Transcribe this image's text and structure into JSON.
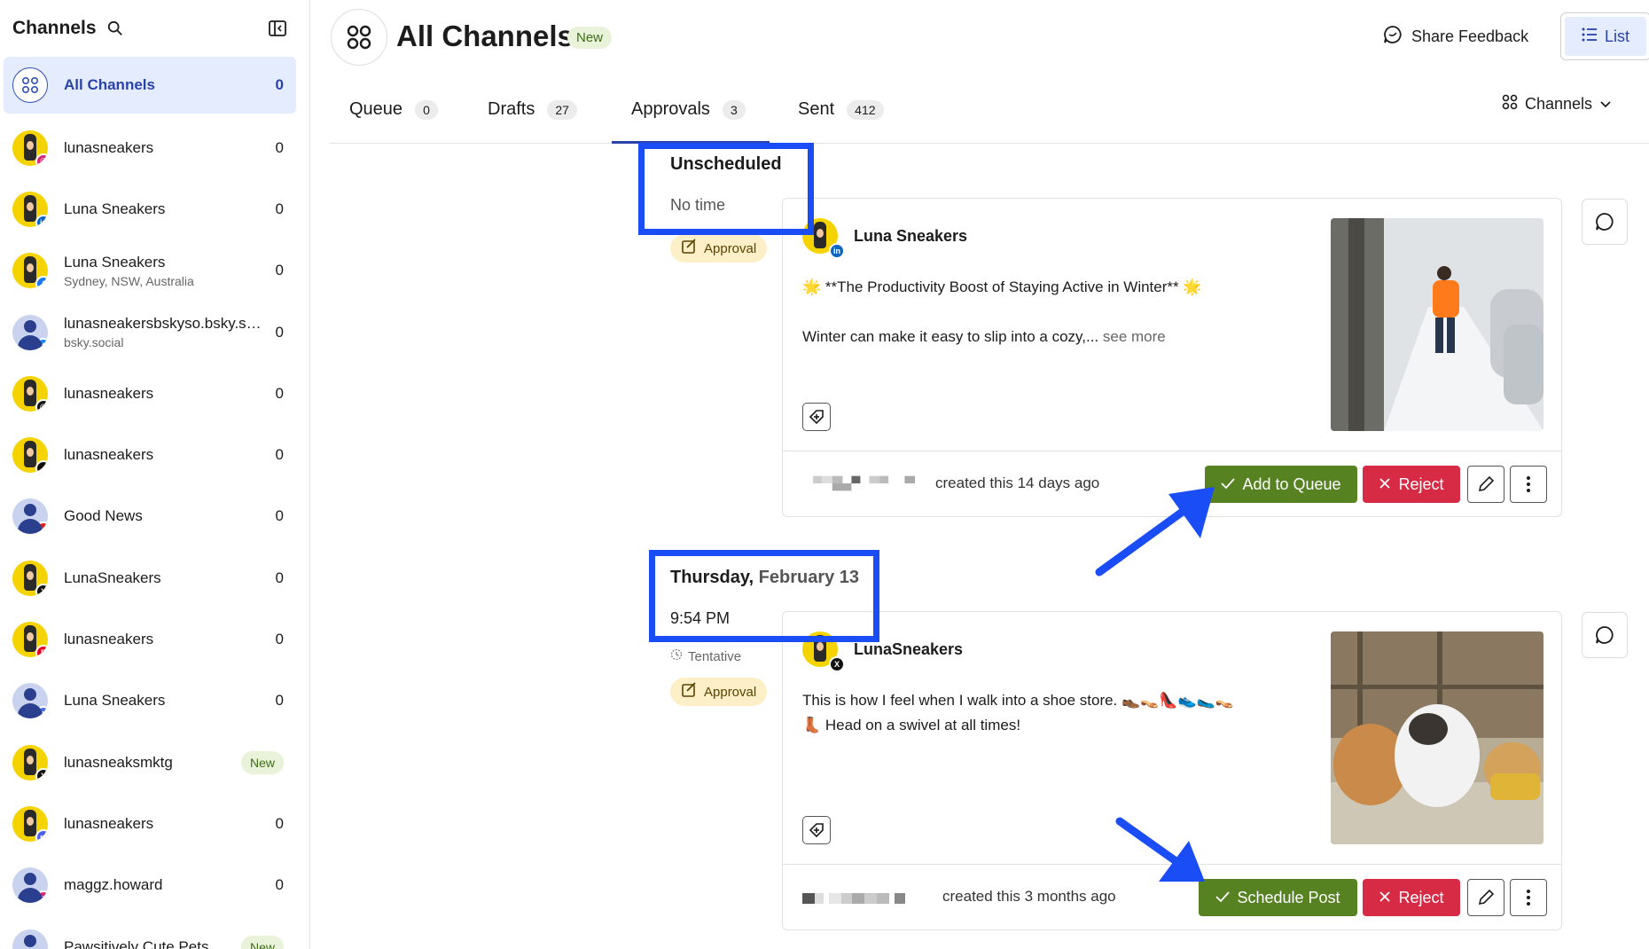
{
  "sidebar": {
    "title": "Channels",
    "channels": [
      {
        "name": "All Channels",
        "sub": "",
        "count": "0",
        "avatar": "all",
        "network": "",
        "active": true
      },
      {
        "name": "lunasneakers",
        "sub": "",
        "count": "0",
        "avatar": "yellow",
        "network": "instagram"
      },
      {
        "name": "Luna Sneakers",
        "sub": "",
        "count": "0",
        "avatar": "yellow",
        "network": "linkedin"
      },
      {
        "name": "Luna Sneakers",
        "sub": "Sydney, NSW, Australia",
        "count": "0",
        "avatar": "yellow",
        "network": "facebook"
      },
      {
        "name": "lunasneakersbskyso.bsky.social",
        "sub": "bsky.social",
        "count": "0",
        "avatar": "blue",
        "network": "bluesky"
      },
      {
        "name": "lunasneakers",
        "sub": "",
        "count": "0",
        "avatar": "yellow",
        "network": "threads"
      },
      {
        "name": "lunasneakers",
        "sub": "",
        "count": "0",
        "avatar": "yellow",
        "network": "tiktok"
      },
      {
        "name": "Good News",
        "sub": "",
        "count": "0",
        "avatar": "blue",
        "network": "youtube"
      },
      {
        "name": "LunaSneakers",
        "sub": "",
        "count": "0",
        "avatar": "yellow",
        "network": "x"
      },
      {
        "name": "lunasneakers",
        "sub": "",
        "count": "0",
        "avatar": "yellow",
        "network": "pinterest"
      },
      {
        "name": "Luna Sneakers",
        "sub": "",
        "count": "0",
        "avatar": "blue",
        "network": "google-business"
      },
      {
        "name": "lunasneaksmktg",
        "sub": "",
        "count": "New",
        "avatar": "yellow",
        "network": "x"
      },
      {
        "name": "lunasneakers",
        "sub": "",
        "count": "0",
        "avatar": "yellow",
        "network": "mastodon"
      },
      {
        "name": "maggz.howard",
        "sub": "",
        "count": "0",
        "avatar": "blue",
        "network": "instagram"
      },
      {
        "name": "Pawsitively Cute Pets",
        "sub": "",
        "count": "New",
        "avatar": "blue",
        "network": "facebook"
      }
    ]
  },
  "header": {
    "title": "All Channels",
    "new_badge": "New",
    "share_feedback": "Share Feedback",
    "list_label": "List",
    "channels_dropdown": "Channels"
  },
  "tabs": [
    {
      "label": "Queue",
      "count": "0"
    },
    {
      "label": "Drafts",
      "count": "27"
    },
    {
      "label": "Approvals",
      "count": "3"
    },
    {
      "label": "Sent",
      "count": "412"
    }
  ],
  "groups": [
    {
      "date_bold": "Unscheduled",
      "date_rest": "",
      "time": "No time",
      "status": "",
      "approval_label": "Approval",
      "post": {
        "author": "Luna Sneakers",
        "network": "linkedin",
        "line1": "🌟 **The Productivity Boost of Staying Active in Winter** 🌟",
        "line2": "Winter can make it easy to slip into a cozy,...",
        "see_more": "see more",
        "created": "created this 14 days ago",
        "primary_action": "Add to Queue",
        "reject": "Reject",
        "image": "person-running-snow"
      }
    },
    {
      "date_bold": "Thursday,",
      "date_rest": "February 13",
      "time": "9:54 PM",
      "status": "Tentative",
      "approval_label": "Approval",
      "post": {
        "author": "LunaSneakers",
        "network": "x",
        "line1": "This is how I feel when I walk into a shoe store. 👞👡👠👟🥿👡",
        "line2": "👢 Head on a swivel at all times!",
        "see_more": "",
        "created": "created this 3 months ago",
        "primary_action": "Schedule Post",
        "reject": "Reject",
        "image": "cats-gif"
      }
    }
  ],
  "colors": {
    "accent": "#2a43a8",
    "approve": "#578221",
    "reject": "#d62a45",
    "annotation": "#1a4df5"
  }
}
